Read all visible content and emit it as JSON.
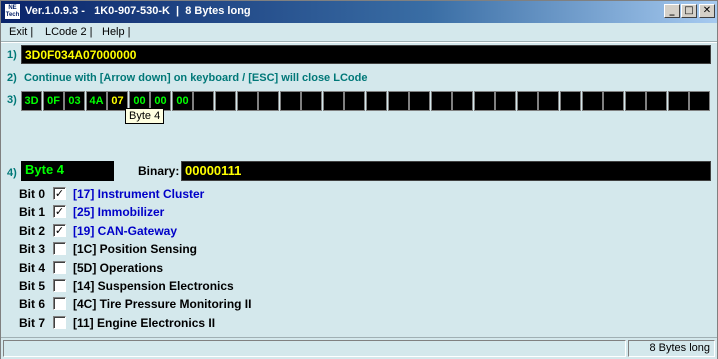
{
  "window": {
    "icon_text": "NE Tech",
    "title": "Ver.1.0.9.3 -   1K0-907-530-K  |  8 Bytes long",
    "controls": {
      "minimize": "_",
      "maximize": "□",
      "close": "✕"
    }
  },
  "menu": {
    "items": [
      "Exit |",
      "LCode 2 |",
      "Help |"
    ]
  },
  "step1": {
    "label": "1)",
    "code": "3D0F034A07000000"
  },
  "step2": {
    "label": "2)",
    "text": "Continue with [Arrow down] on keyboard / [ESC] will close LCode"
  },
  "step3": {
    "label": "3)",
    "bytes": [
      "3D",
      "0F",
      "03",
      "4A",
      "07",
      "00",
      "00",
      "00",
      "",
      "",
      "",
      "",
      "",
      "",
      "",
      "",
      "",
      "",
      "",
      "",
      "",
      "",
      "",
      "",
      "",
      "",
      "",
      "",
      "",
      "",
      "",
      ""
    ],
    "selected_index": 4,
    "tooltip": "Byte 4"
  },
  "step4": {
    "label": "4)",
    "byte_name": "Byte 4",
    "binary_label": "Binary:",
    "binary_value": "00000111"
  },
  "bits": [
    {
      "label": "Bit 0",
      "checked": true,
      "text": "[17] Instrument Cluster",
      "color": "#0000C8"
    },
    {
      "label": "Bit 1",
      "checked": true,
      "text": "[25] Immobilizer",
      "color": "#0000C8"
    },
    {
      "label": "Bit 2",
      "checked": true,
      "text": "[19] CAN-Gateway",
      "color": "#0000C8"
    },
    {
      "label": "Bit 3",
      "checked": false,
      "text": "[1C] Position Sensing",
      "color": "#000000"
    },
    {
      "label": "Bit 4",
      "checked": false,
      "text": "[5D] Operations",
      "color": "#000000"
    },
    {
      "label": "Bit 5",
      "checked": false,
      "text": "[14] Suspension Electronics",
      "color": "#000000"
    },
    {
      "label": "Bit 6",
      "checked": false,
      "text": "[4C] Tire Pressure Monitoring II",
      "color": "#000000"
    },
    {
      "label": "Bit 7",
      "checked": false,
      "text": "[11] Engine Electronics II",
      "color": "#000000"
    }
  ],
  "status": {
    "left": "",
    "right": "8 Bytes long"
  }
}
